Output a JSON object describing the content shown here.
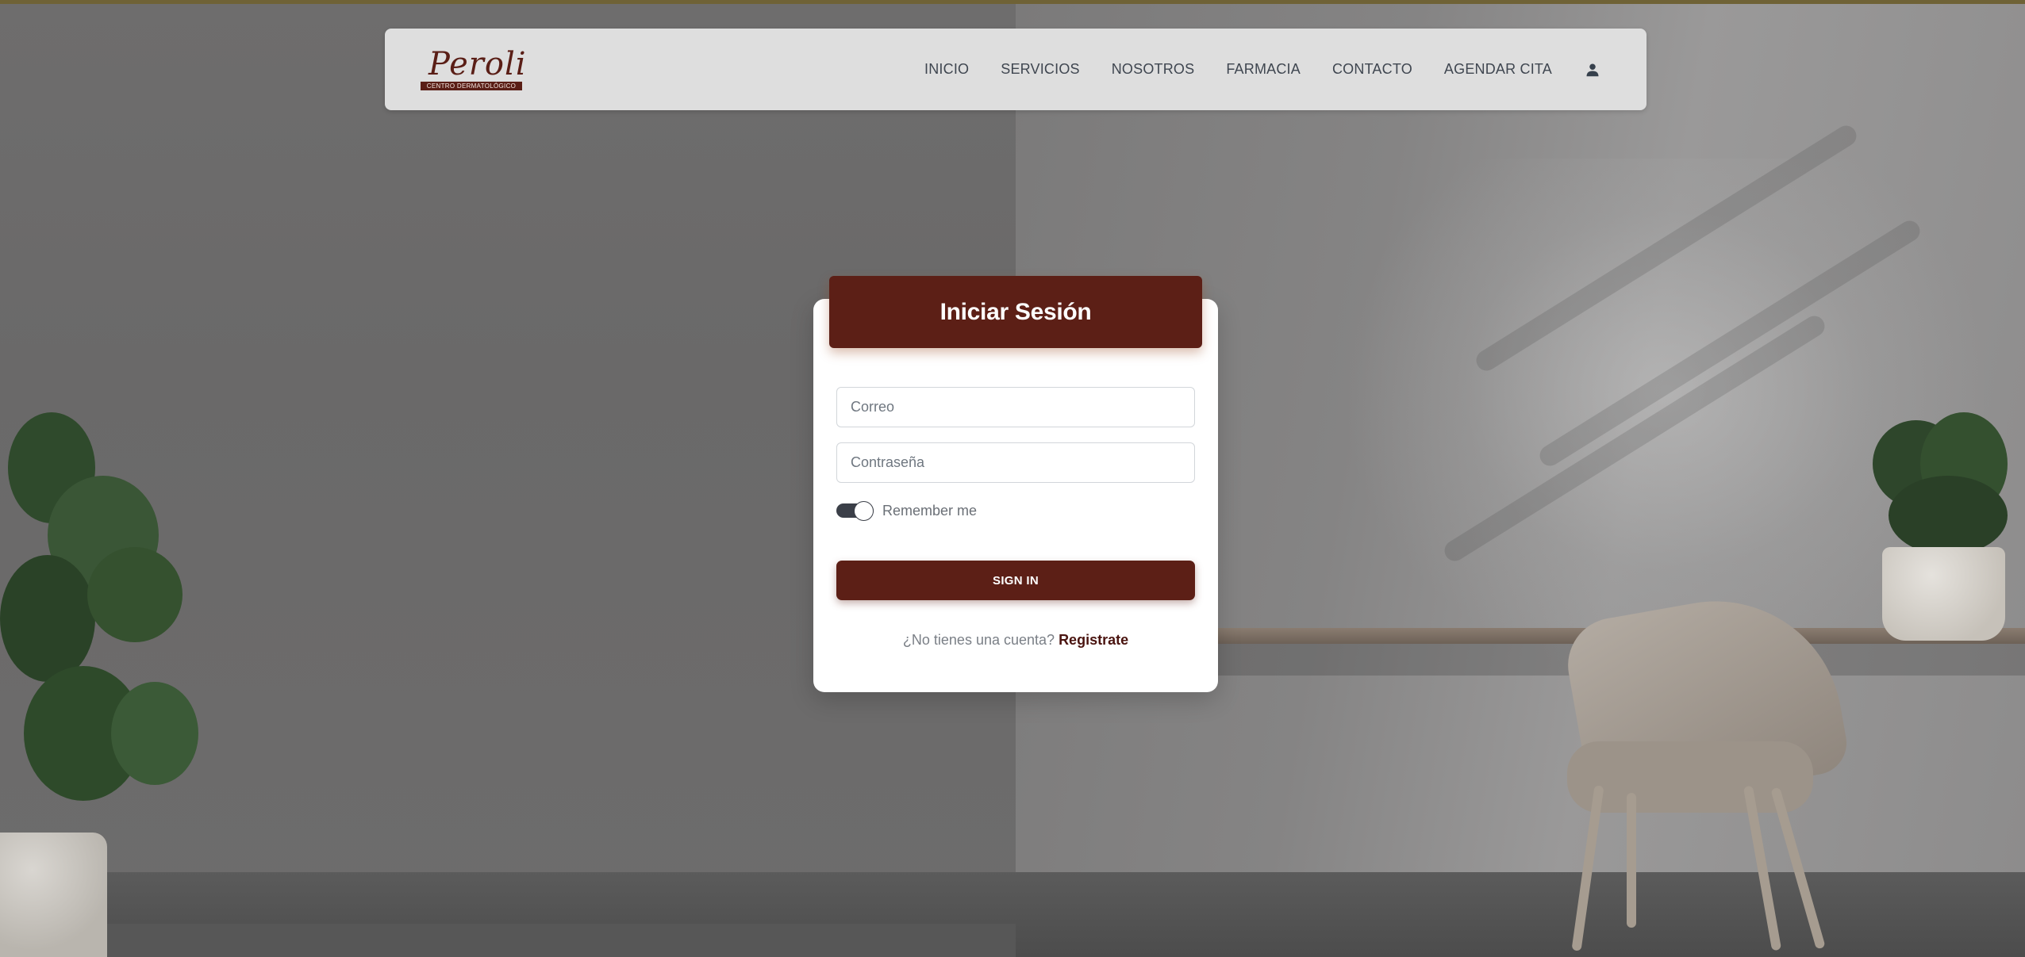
{
  "brand": {
    "script": "Peroli",
    "tagline": "CENTRO DERMATOLÓGICO"
  },
  "nav": {
    "links": [
      {
        "label": "INICIO"
      },
      {
        "label": "SERVICIOS"
      },
      {
        "label": "NOSOTROS"
      },
      {
        "label": "FARMACIA"
      },
      {
        "label": "CONTACTO"
      },
      {
        "label": "AGENDAR CITA"
      }
    ],
    "user_icon": "user-icon"
  },
  "login": {
    "title": "Iniciar Sesión",
    "email_placeholder": "Correo",
    "email_value": "",
    "password_placeholder": "Contraseña",
    "password_value": "",
    "remember_label": "Remember me",
    "remember_checked": true,
    "submit_label": "SIGN IN",
    "signup_prompt": "¿No tienes una cuenta?",
    "signup_link": "Registrate"
  },
  "colors": {
    "brand": "#5c1f16",
    "navbar_bg": "#dedede",
    "card_bg": "#ffffff"
  }
}
